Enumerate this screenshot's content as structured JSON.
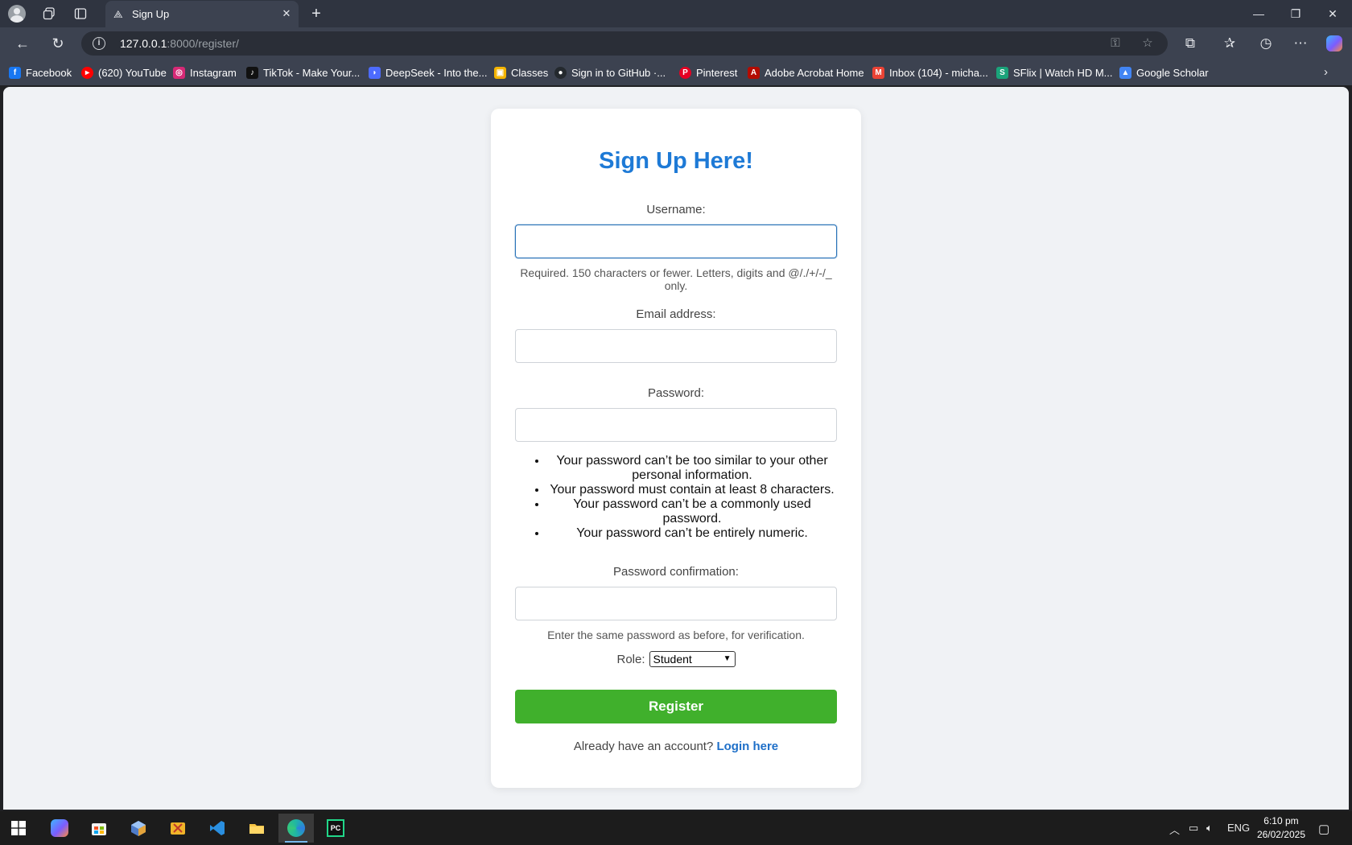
{
  "browser": {
    "tab_title": "Sign Up",
    "url_host": "127.0.0.1",
    "url_rest": ":8000/register/",
    "bookmarks": [
      {
        "label": "Facebook",
        "color": "#1877f2"
      },
      {
        "label": "(620) YouTube",
        "color": "#ff0000"
      },
      {
        "label": "Instagram",
        "color": "#d62976"
      },
      {
        "label": "TikTok - Make Your...",
        "color": "#111111"
      },
      {
        "label": "DeepSeek - Into the...",
        "color": "#4d6bfe"
      },
      {
        "label": "Classes",
        "color": "#f4b400"
      },
      {
        "label": "Sign in to GitHub ·...",
        "color": "#24292e"
      },
      {
        "label": "Pinterest",
        "color": "#e60023"
      },
      {
        "label": "Adobe Acrobat Home",
        "color": "#b30b00"
      },
      {
        "label": "Inbox (104) - micha...",
        "color": "#ea4335"
      },
      {
        "label": "SFlix | Watch HD M...",
        "color": "#1aa37a"
      },
      {
        "label": "Google Scholar",
        "color": "#4285f4"
      }
    ]
  },
  "form": {
    "heading": "Sign Up Here!",
    "username_label": "Username:",
    "username_value": "",
    "username_help": "Required. 150 characters or fewer. Letters, digits and @/./+/-/_ only.",
    "email_label": "Email address:",
    "email_value": "",
    "password_label": "Password:",
    "password_value": "",
    "password_rules": [
      "Your password can’t be too similar to your other personal information.",
      "Your password must contain at least 8 characters.",
      "Your password can’t be a commonly used password.",
      "Your password can’t be entirely numeric."
    ],
    "password2_label": "Password confirmation:",
    "password2_value": "",
    "password2_help": "Enter the same password as before, for verification.",
    "role_label": "Role:",
    "role_selected": "Student",
    "register_label": "Register",
    "login_prompt": "Already have an account?",
    "login_link": "Login here"
  },
  "taskbar": {
    "language": "ENG",
    "time": "6:10 pm",
    "date": "26/02/2025"
  },
  "colors": {
    "accent": "#1e7ad6",
    "register": "#40b02c",
    "link": "#1e6fc8"
  }
}
